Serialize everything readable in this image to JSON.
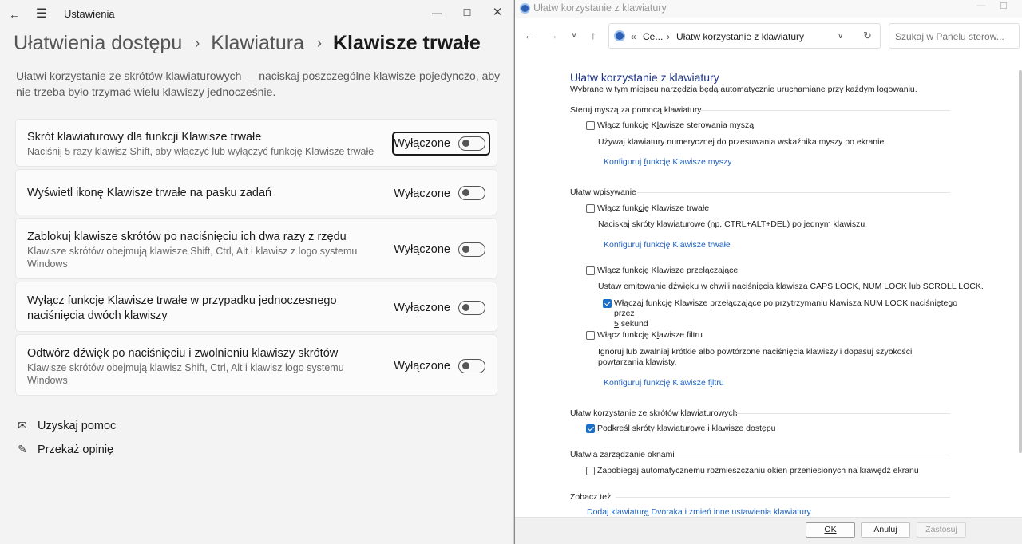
{
  "settings": {
    "window_title": "Ustawienia",
    "breadcrumb": [
      "Ułatwienia dostępu",
      "Klawiatura",
      "Klawisze trwałe"
    ],
    "description": "Ułatwi korzystanie ze skrótów klawiaturowych — naciskaj poszczególne klawisze pojedynczo, aby nie trzeba było trzymać wielu klawiszy jednocześnie.",
    "cards": [
      {
        "title": "Skrót klawiaturowy dla funkcji Klawisze trwałe",
        "subtitle": "Naciśnij 5 razy klawisz Shift, aby włączyć lub wyłączyć funkcję Klawisze trwałe",
        "state": "Wyłączone",
        "toggle_on": false,
        "focused": true
      },
      {
        "title": "Wyświetl ikonę Klawisze trwałe na pasku zadań",
        "subtitle": "",
        "state": "Wyłączone",
        "toggle_on": false
      },
      {
        "title": "Zablokuj klawisze skrótów po naciśnięciu ich dwa razy z rzędu",
        "subtitle": "Klawisze skrótów obejmują klawisze Shift, Ctrl, Alt i klawisz z logo systemu Windows",
        "state": "Wyłączone",
        "toggle_on": false
      },
      {
        "title": "Wyłącz funkcję Klawisze trwałe w przypadku jednoczesnego naciśnięcia dwóch klawiszy",
        "subtitle": "",
        "state": "Wyłączone",
        "toggle_on": false
      },
      {
        "title": "Odtwórz dźwięk po naciśnięciu i zwolnieniu klawiszy skrótów",
        "subtitle": "Klawisze skrótów obejmują klawisz Shift, Ctrl, Alt i klawisz logo systemu Windows",
        "state": "Wyłączone",
        "toggle_on": false
      }
    ],
    "help": {
      "get_help": "Uzyskaj pomoc",
      "feedback": "Przekaż opinię"
    }
  },
  "cpanel": {
    "window_title": "Ułatw korzystanie z klawiatury",
    "address": {
      "root": "Ce...",
      "current": "Ułatw korzystanie z klawiatury"
    },
    "search_placeholder": "Szukaj w Panelu sterow...",
    "heading": "Ułatw korzystanie z klawiatury",
    "subheading": "Wybrane w tym miejscu narzędzia będą automatycznie uruchamiane przy każdym logowaniu.",
    "mouse": {
      "section": "Steruj myszą za pomocą klawiatury",
      "chk_pre": "Włącz funkcję K",
      "chk_u": "l",
      "chk_post": "awisze sterowania myszą",
      "desc": "Używaj klawiatury numerycznej do przesuwania wskaźnika myszy po ekranie.",
      "link_pre": "Konfiguruj ",
      "link_u": "f",
      "link_post": "unkcję Klawisze myszy"
    },
    "typing": {
      "section": "Ułatw wpisywanie",
      "sticky_pre": "Włącz funk",
      "sticky_u": "c",
      "sticky_post": "ję Klawisze trwałe",
      "sticky_desc": "Naciskaj skróty klawiaturowe (np. CTRL+ALT+DEL) po jednym klawiszu.",
      "sticky_link": "Konfiguruj funkcję Klawisze trwałe",
      "toggle_pre": "Włącz funkcję K",
      "toggle_u": "l",
      "toggle_post": "awisze przełączające",
      "toggle_desc": "Ustaw emitowanie dźwięku w chwili naciśnięcia klawisza CAPS LOCK, NUM LOCK lub SCROLL LOCK.",
      "toggle_hold_line1": "Włączaj funkcję Klawisze przełączające po przytrzymaniu klawisza NUM LOCK naciśniętego przez",
      "toggle_hold_u": "5",
      "toggle_hold_post": " sekund",
      "filter_pre": "Włącz funkcję K",
      "filter_u": "l",
      "filter_post": "awisze filtru",
      "filter_desc": "Ignoruj lub zwalniaj krótkie albo powtórzone naciśnięcia klawiszy i dopasuj szybkości powtarzania klawisty.",
      "filter_link_pre": "Konfiguruj funkcję Klawisze f",
      "filter_link_u": "i",
      "filter_link_post": "ltru"
    },
    "shortcuts": {
      "section": "Ułatw korzystanie ze skrótów klawiaturowych",
      "chk_pre": "Po",
      "chk_u": "d",
      "chk_post": "kreśl skróty klawiaturowe i klawisze dostępu"
    },
    "windows": {
      "section": "Ułatwia zarządzanie oknami",
      "chk": "Zapobiegaj automatycznemu rozmieszczaniu okien przeniesionych na krawędź ekranu"
    },
    "see_also": {
      "section": "Zobacz też",
      "link_pre": "Dodaj klawiatur",
      "link_u": "ę",
      "link_post": " Dvoraka i zmień inne ustawienia klawiatury"
    },
    "buttons": {
      "ok": "OK",
      "cancel": "Anuluj",
      "apply": "Zastosuj"
    },
    "checked": {
      "mouse": false,
      "sticky": false,
      "toggle": false,
      "toggle_hold": true,
      "filter": false,
      "shortcuts": true,
      "windows": false
    }
  }
}
